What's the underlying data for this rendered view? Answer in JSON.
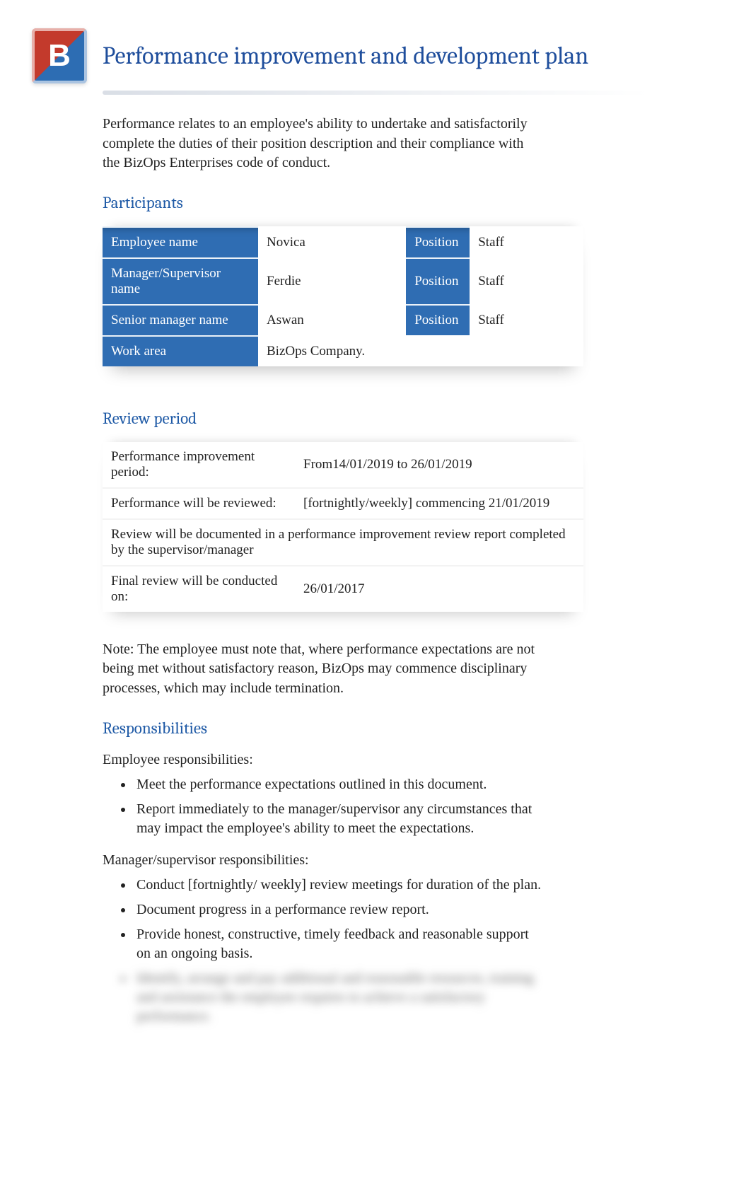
{
  "logo_letter": "B",
  "title": "Performance improvement and development plan",
  "intro": "Performance relates to an employee's ability to undertake and satisfactorily complete the duties of their position description and their compliance with the BizOps Enterprises code of conduct.",
  "sections": {
    "participants": "Participants",
    "review": "Review period",
    "responsibilities": "Responsibilities"
  },
  "participants": {
    "rows": [
      {
        "label": "Employee name",
        "value": "Novica",
        "pos_label": "Position",
        "pos_value": "Staff"
      },
      {
        "label": "Manager/Supervisor name",
        "value": "Ferdie",
        "pos_label": "Position",
        "pos_value": "Staff"
      },
      {
        "label": "Senior manager name",
        "value": "Aswan",
        "pos_label": "Position",
        "pos_value": "Staff"
      }
    ],
    "work_area_label": "Work area",
    "work_area_value": "BizOps Company."
  },
  "review": {
    "rows": [
      {
        "label": "Performance improvement period:",
        "value": "From14/01/2019 to 26/01/2019"
      },
      {
        "label": "Performance will be reviewed:",
        "value": "[fortnightly/weekly] commencing 21/01/2019"
      }
    ],
    "full_row": "Review will be documented in a performance improvement review report completed by the supervisor/manager",
    "final_label": "Final review will be conducted on:",
    "final_value": "26/01/2017"
  },
  "note": "Note:  The employee must note that, where performance expectations are not being met without satisfactory reason, BizOps may commence disciplinary processes, which may include termination.",
  "responsibilities": {
    "employee_lead": "Employee responsibilities:",
    "employee_items": [
      "Meet the performance expectations outlined in this document.",
      "Report immediately to the manager/supervisor any circumstances that may impact the employee's ability to meet the expectations."
    ],
    "manager_lead": "Manager/supervisor responsibilities:",
    "manager_items": [
      "Conduct [fortnightly/ weekly] review meetings for duration of the plan.",
      "Document progress in a performance review report.",
      "Provide honest, constructive, timely feedback and reasonable support on an ongoing basis."
    ],
    "blurred_item": "Identify, arrange and pay additional and reasonable resources, training and assistance the employee requires to achieve a satisfactory performance."
  }
}
